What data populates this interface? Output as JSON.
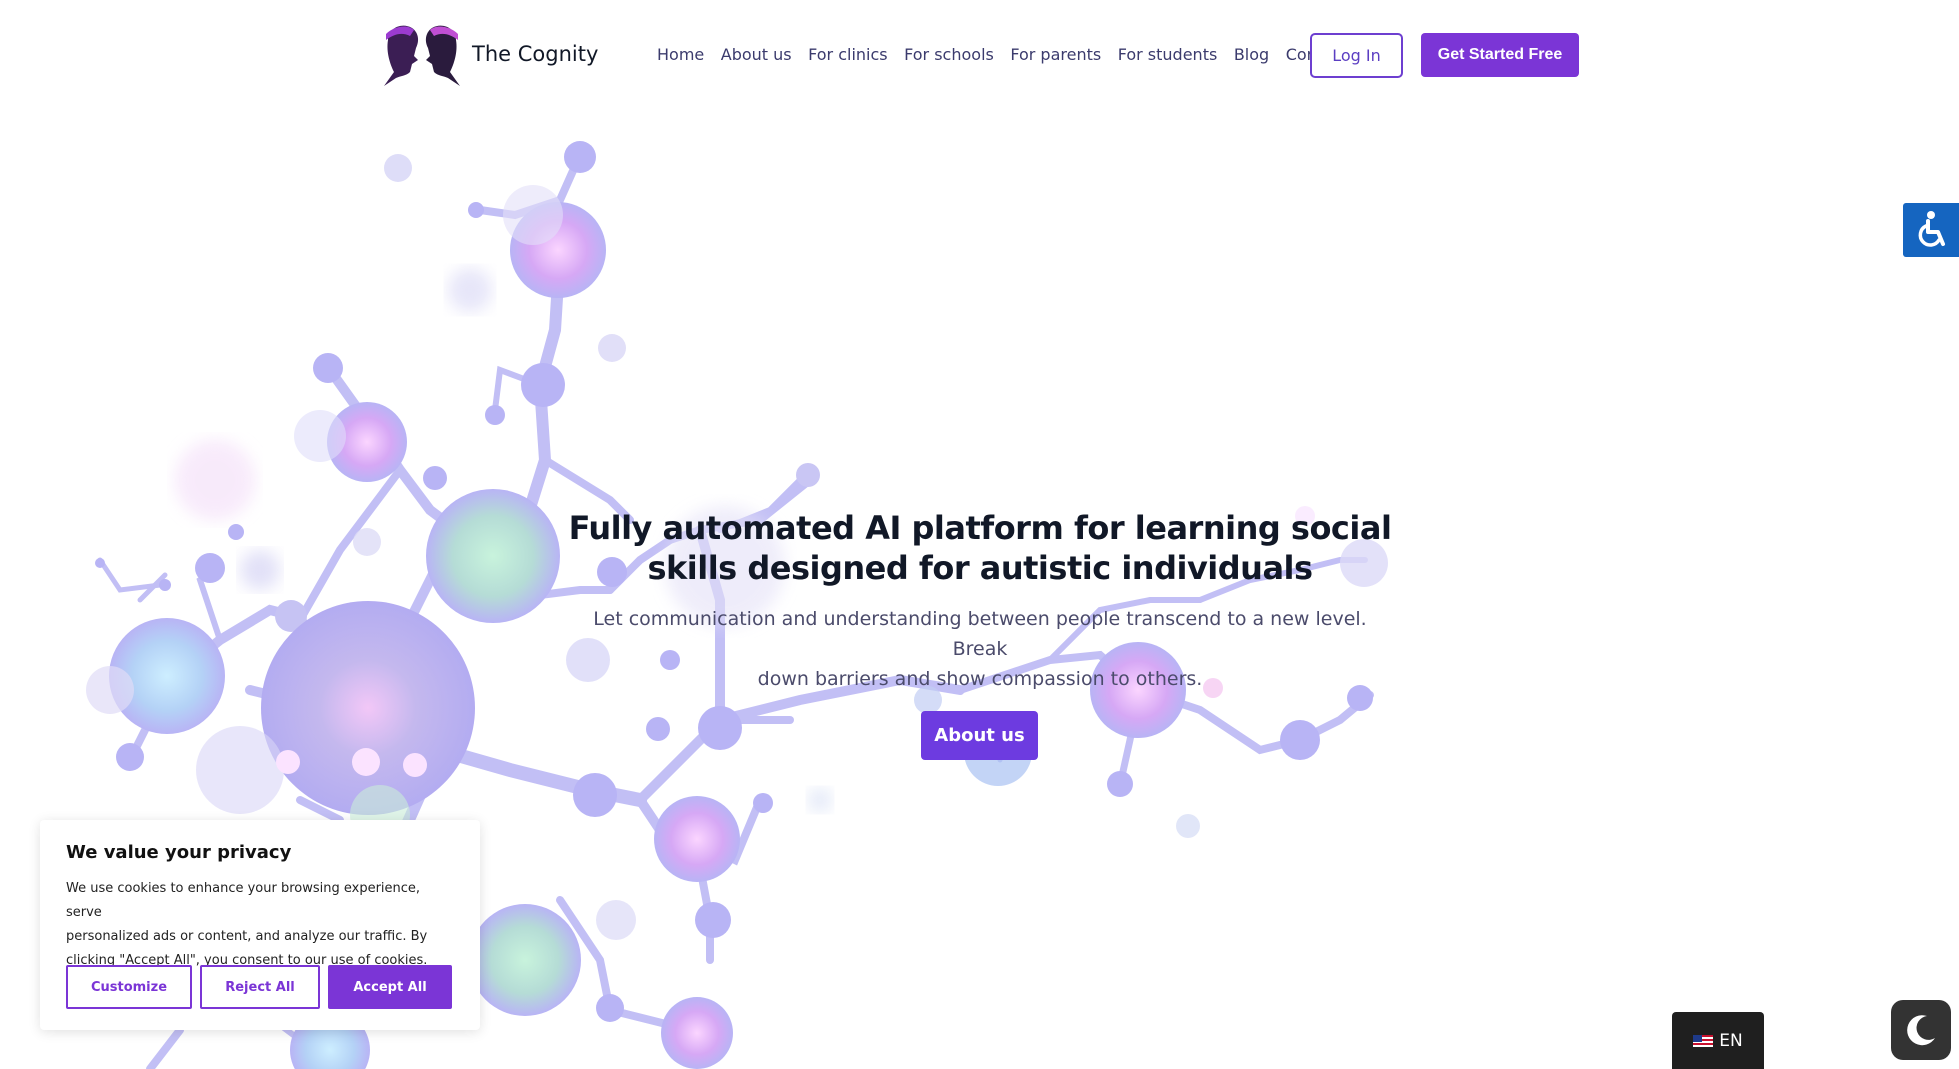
{
  "brand": {
    "name": "The Cognity"
  },
  "nav": {
    "items": [
      {
        "label": "Home"
      },
      {
        "label": "About us"
      },
      {
        "label": "For clinics"
      },
      {
        "label": "For schools"
      },
      {
        "label": "For parents"
      },
      {
        "label": "For students"
      },
      {
        "label": "Blog"
      },
      {
        "label": "Contact"
      }
    ],
    "login_label": "Log In",
    "cta_label": "Get Started Free"
  },
  "hero": {
    "title_line1": "Fully automated AI platform for learning social",
    "title_line2": "skills designed for autistic individuals",
    "subtitle_line1": "Let communication and understanding between people transcend to a new level. Break",
    "subtitle_line2": "down barriers and show compassion to others.",
    "button_label": "About us"
  },
  "cookie": {
    "title": "We value your privacy",
    "line1": "We use cookies to enhance your browsing experience, serve",
    "line2": "personalized ads or content, and analyze our traffic. By",
    "line3": "clicking \"Accept All\", you consent to our use of cookies.",
    "customize_label": "Customize",
    "reject_label": "Reject All",
    "accept_label": "Accept All"
  },
  "language": {
    "code": "EN"
  },
  "icons": {
    "accessibility": "accessibility-icon",
    "darkmode": "moon-icon",
    "flag": "us-flag-icon"
  },
  "colors": {
    "primary": "#7b35d6",
    "accessibility_bg": "#1565c0",
    "lang_bg": "#1f1f1f",
    "molecule": "#b8b4f5"
  }
}
